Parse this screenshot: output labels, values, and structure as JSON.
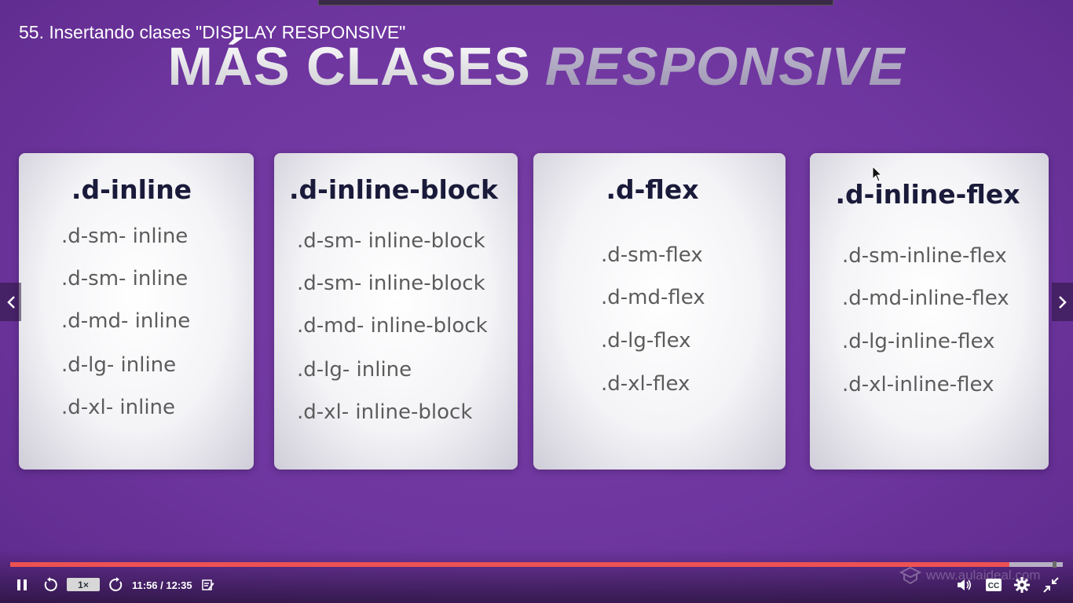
{
  "lecture": {
    "title": "55. Insertando clases \"DISPLAY RESPONSIVE\""
  },
  "slide": {
    "heading_part1": "MÁS CLASES",
    "heading_part2": "RESPONSIVE",
    "cards": [
      {
        "title": ".d-inline",
        "items": [
          ".d-sm- inline",
          ".d-sm- inline",
          ".d-md- inline",
          ".d-lg- inline",
          ".d-xl- inline"
        ]
      },
      {
        "title": ".d-inline-block",
        "items": [
          ".d-sm- inline-block",
          ".d-sm- inline-block",
          ".d-md- inline-block",
          ".d-lg- inline",
          ".d-xl- inline-block"
        ]
      },
      {
        "title": ".d-flex",
        "items": [
          ".d-sm-flex",
          ".d-md-flex",
          ".d-lg-flex",
          ".d-xl-flex"
        ]
      },
      {
        "title": ".d-inline-flex",
        "items": [
          ".d-sm-inline-flex",
          ".d-md-inline-flex",
          ".d-lg-inline-flex",
          ".d-xl-inline-flex"
        ]
      }
    ]
  },
  "nav": {
    "prev_icon": "chevron-left-icon",
    "next_icon": "chevron-right-icon"
  },
  "player": {
    "speed": "1×",
    "time": "11:56 / 12:35",
    "progress": 0.949,
    "buffered": 1.0,
    "watermark": "www.aulaideal.com"
  },
  "colors": {
    "accent": "#ec5252",
    "background": "#7a3fa8",
    "card_title": "#1a1a3a"
  }
}
